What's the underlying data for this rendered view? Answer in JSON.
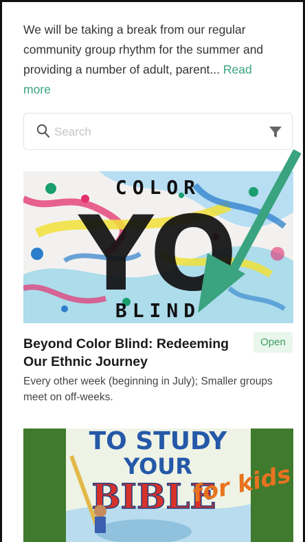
{
  "intro": {
    "text": "We will be taking a break from our regular community group rhythm for the summer and providing a number of adult, parent...",
    "read_more": "Read more"
  },
  "search": {
    "placeholder": "Search",
    "icon": "search-icon",
    "filter_icon": "filter-icon"
  },
  "groups": [
    {
      "image": {
        "title_top": "COLOR",
        "title_middle": "YO",
        "title_bottom": "BLIND"
      },
      "title": "Beyond Color Blind: Redeeming Our Ethnic Journey",
      "status": "Open",
      "description": "Every other week (beginning in July); Smaller groups meet on off-weeks."
    },
    {
      "image": {
        "line1": "TO STUDY",
        "line2": "YOUR",
        "line3": "BIBLE",
        "line4": "for kids"
      }
    }
  ],
  "annotation": {
    "arrow_color": "#3aa37f"
  },
  "colors": {
    "accent": "#3aa37f",
    "badge_bg": "#e8f6ec",
    "badge_text": "#3e9e5e"
  }
}
